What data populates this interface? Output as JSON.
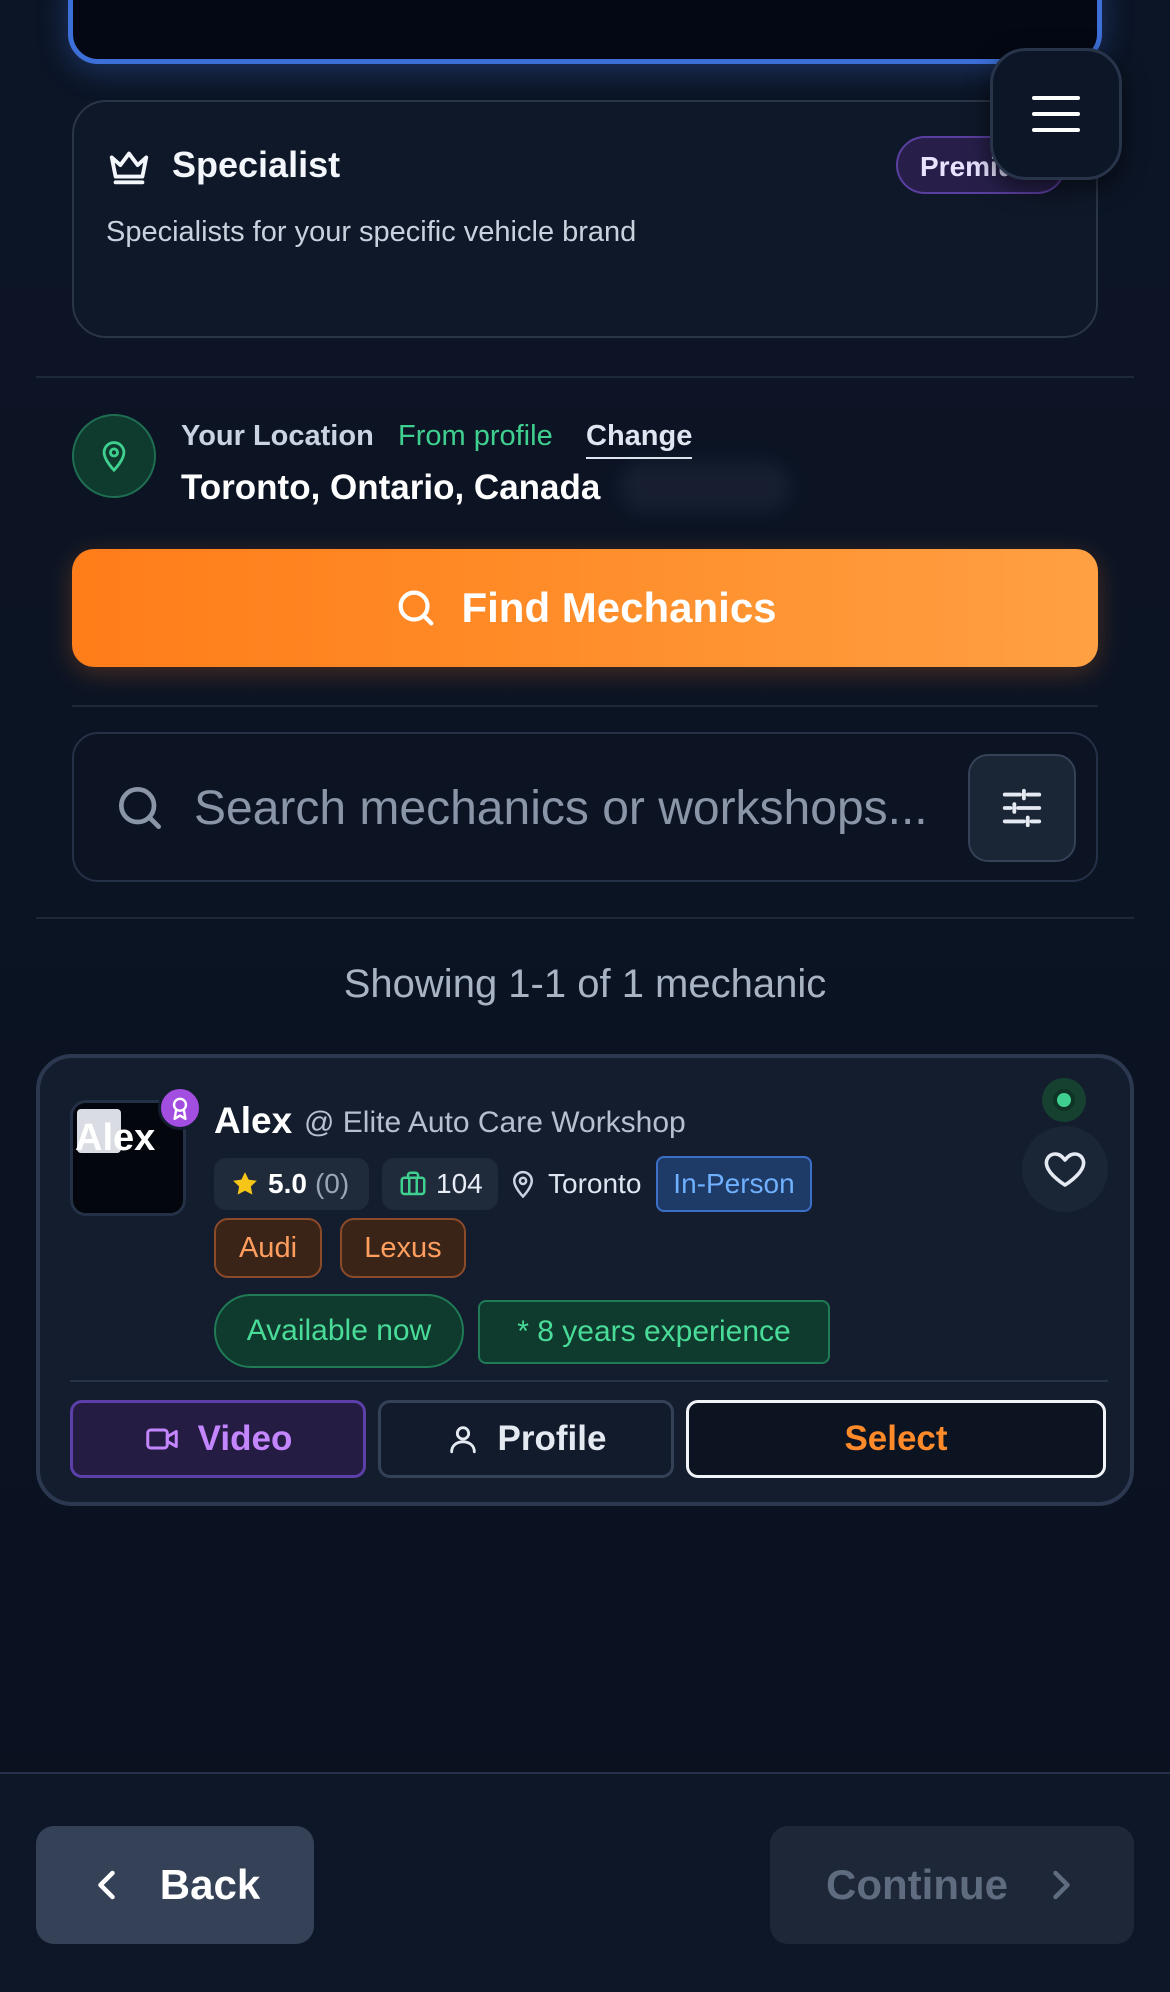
{
  "specialist": {
    "title": "Specialist",
    "badge": "Premium",
    "description": "Specialists for your specific vehicle brand"
  },
  "location": {
    "label": "Your Location",
    "source": "From profile",
    "change": "Change",
    "value": "Toronto, Ontario, Canada"
  },
  "find_button": "Find Mechanics",
  "search": {
    "placeholder": "Search mechanics or workshops...",
    "value": ""
  },
  "results": "Showing 1-1 of 1 mechanic",
  "mechanic": {
    "avatar_alt": "Alex",
    "name": "Alex",
    "workshop": "@ Elite Auto Care Workshop",
    "rating": "5.0",
    "rating_count": "(0)",
    "jobs": "104",
    "city": "Toronto",
    "service_mode": "In-Person",
    "brands": [
      "Audi",
      "Lexus"
    ],
    "availability": "Available now",
    "experience": "* 8 years experience",
    "buttons": {
      "video": "Video",
      "profile": "Profile",
      "select": "Select"
    }
  },
  "footer": {
    "back": "Back",
    "continue": "Continue"
  },
  "icons": [
    "crown-icon",
    "menu-icon",
    "location-pin-icon",
    "search-icon",
    "filter-sliders-icon",
    "award-icon",
    "star-icon",
    "briefcase-icon",
    "map-pin-icon",
    "heart-icon",
    "video-camera-icon",
    "user-icon",
    "chevron-left-icon",
    "chevron-right-icon"
  ],
  "colors": {
    "accent_orange": "#ff8a26",
    "success_green": "#3fd08f",
    "premium_purple": "#5b3fa0",
    "info_blue": "#3b6fc8"
  }
}
